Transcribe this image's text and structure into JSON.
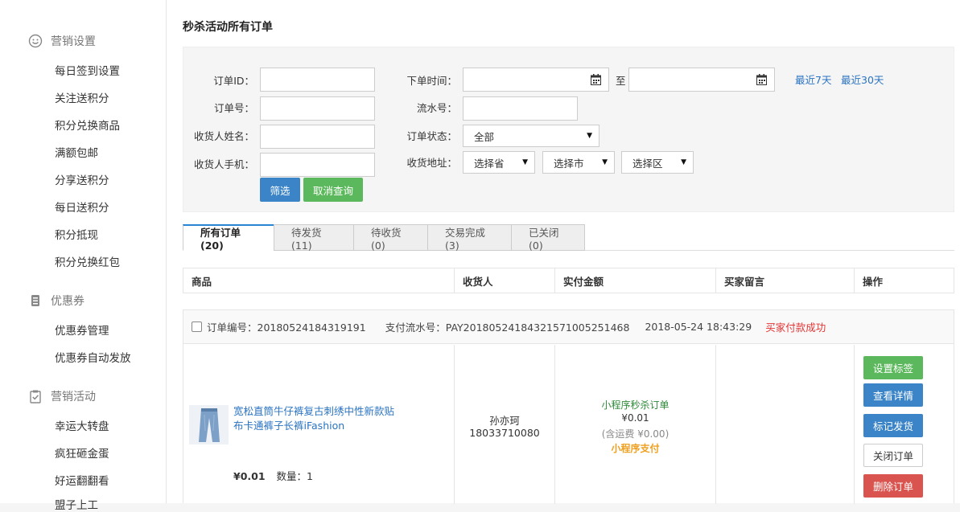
{
  "sidebar": {
    "sections": [
      {
        "title": "营销设置",
        "icon": "smile-icon",
        "items": [
          "每日签到设置",
          "关注送积分",
          "积分兑换商品",
          "满额包邮",
          "分享送积分",
          "每日送积分",
          "积分抵现",
          "积分兑换红包"
        ]
      },
      {
        "title": "优惠券",
        "icon": "coupon-icon",
        "items": [
          "优惠券管理",
          "优惠券自动发放"
        ]
      },
      {
        "title": "营销活动",
        "icon": "clipboard-check-icon",
        "items": [
          "幸运大转盘",
          "疯狂砸金蛋",
          "好运翻翻看",
          "盟子上工"
        ]
      }
    ]
  },
  "page_title": "秒杀活动所有订单",
  "filter": {
    "order_id_label": "订单ID：",
    "order_no_label": "订单号：",
    "receiver_name_label": "收货人姓名：",
    "receiver_phone_label": "收货人手机：",
    "order_time_label": "下单时间：",
    "to_label": "至",
    "serial_label": "流水号：",
    "status_label": "订单状态：",
    "status_value": "全部",
    "address_label": "收货地址：",
    "province": "选择省",
    "city": "选择市",
    "district": "选择区",
    "last7": "最近7天",
    "last30": "最近30天",
    "filter_btn": "筛选",
    "cancel_btn": "取消查询"
  },
  "tabs": [
    "所有订单(20)",
    "待发货(11)",
    "待收货(0)",
    "交易完成(3)",
    "已关闭(0)"
  ],
  "table_headers": [
    "商品",
    "收货人",
    "实付金额",
    "买家留言",
    "操作"
  ],
  "order": {
    "order_no": "订单编号：20180524184319191",
    "pay_serial": "支付流水号：PAY20180524184321571005251468",
    "time": "2018-05-24 18:43:29",
    "status": "买家付款成功",
    "product_name": "宽松直筒牛仔裤复古刺绣中性新款贴布卡通裤子长裤iFashion",
    "price": "¥0.01",
    "quantity": "数量：1",
    "receiver_name": "孙亦珂",
    "receiver_phone": "18033710080",
    "order_type": "小程序秒杀订单",
    "paid_amount": "¥0.01",
    "shipping_note": "(含运费 ¥0.00)",
    "pay_method": "小程序支付",
    "actions": [
      "设置标签",
      "查看详情",
      "标记发货",
      "关闭订单",
      "删除订单"
    ]
  },
  "colors": {
    "link": "#2a73c2",
    "green": "#5cb85c",
    "blue": "#3a84c7",
    "red": "#d9534f",
    "status_red": "#e53333",
    "orange": "#f0a020"
  }
}
